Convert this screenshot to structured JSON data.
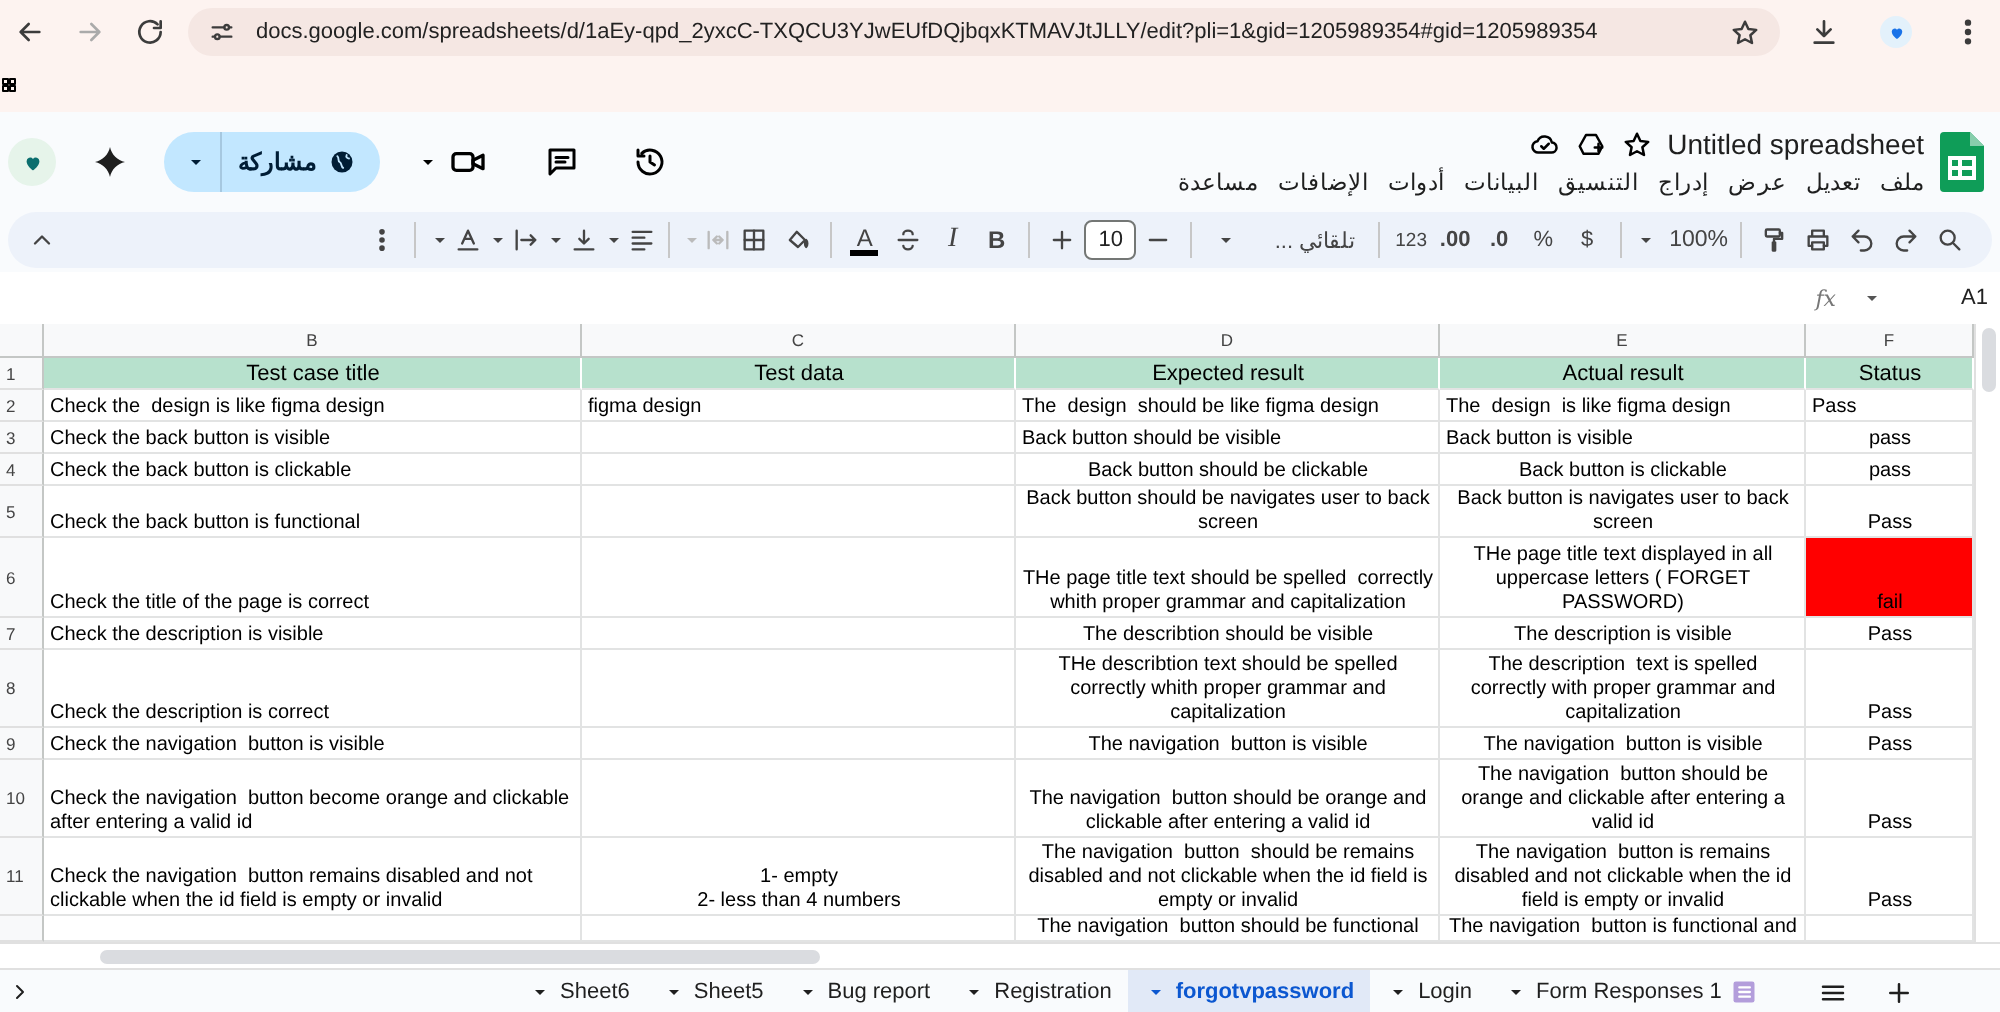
{
  "browser": {
    "url": "docs.google.com/spreadsheets/d/1aEy-qpd_2yxcC-TXQCU3YJwEUfDQjbqxKTMAVJtJLLY/edit?pli=1&gid=1205989354#gid=1205989354"
  },
  "document": {
    "title": "Untitled spreadsheet",
    "share_label": "مشاركة",
    "menu": [
      "ملف",
      "تعديل",
      "عرض",
      "إدراج",
      "التنسيق",
      "البيانات",
      "أدوات",
      "الإضافات",
      "مساعدة"
    ]
  },
  "toolbar": {
    "zoom": "100%",
    "currency": "$",
    "percent": "%",
    "decrease_decimals": ".0",
    "increase_decimals": ".00",
    "number_format": "123",
    "font": "تلقائي ...",
    "font_size": "10",
    "bold": "B",
    "italic": "I",
    "text_color": "A"
  },
  "formula_bar": {
    "fx": "fx",
    "cell_ref": "A1"
  },
  "table": {
    "columns": [
      "B",
      "C",
      "D",
      "E",
      "F"
    ],
    "header_row": {
      "number": "1",
      "cells": [
        "Test case title",
        "Test data",
        "Expected result",
        "Actual result",
        "Status"
      ]
    },
    "rows": [
      {
        "number": "2",
        "cells": [
          {
            "text": "Check the  design is like figma design",
            "centered": false
          },
          {
            "text": "figma design",
            "centered": false
          },
          {
            "text": "The  design  should be like figma design",
            "centered": false
          },
          {
            "text": "The  design  is like figma design",
            "centered": false
          },
          {
            "text": "Pass",
            "centered": false
          }
        ]
      },
      {
        "number": "3",
        "cells": [
          {
            "text": "Check the back button is visible",
            "centered": false
          },
          null,
          {
            "text": "Back button should be visible",
            "centered": false
          },
          {
            "text": "Back button is visible",
            "centered": false
          },
          {
            "text": "pass",
            "centered": true
          }
        ]
      },
      {
        "number": "4",
        "cells": [
          {
            "text": "Check the back button is clickable",
            "centered": false
          },
          null,
          {
            "text": "Back button should be clickable",
            "centered": true
          },
          {
            "text": "Back button is clickable",
            "centered": true
          },
          {
            "text": "pass",
            "centered": true
          }
        ]
      },
      {
        "number": "5",
        "cells": [
          {
            "text": "Check the back button is functional",
            "centered": false
          },
          null,
          {
            "text": "Back button should be navigates user to back screen",
            "centered": true
          },
          {
            "text": "Back button is navigates user to back screen",
            "centered": true
          },
          {
            "text": "Pass",
            "centered": true
          }
        ]
      },
      {
        "number": "6",
        "cells": [
          {
            "text": "Check the title of the page is correct",
            "centered": false
          },
          null,
          {
            "text": "THe page title text should be spelled  correctly whith proper grammar and capitalization",
            "centered": true
          },
          {
            "text": "THe page title text displayed in all uppercase letters ( FORGET PASSWORD)",
            "centered": true
          },
          {
            "text": "fail",
            "centered": true,
            "color": "#ff0000"
          }
        ]
      },
      {
        "number": "7",
        "cells": [
          {
            "text": "Check the description is visible",
            "centered": false
          },
          null,
          {
            "text": "The describtion should be visible",
            "centered": true
          },
          {
            "text": "The description is visible",
            "centered": true
          },
          {
            "text": "Pass",
            "centered": true
          }
        ]
      },
      {
        "number": "8",
        "cells": [
          {
            "text": "Check the description is correct",
            "centered": false
          },
          null,
          {
            "text": "THe describtion text should be spelled correctly whith proper grammar and capitalization",
            "centered": true
          },
          {
            "text": "The description  text is spelled  correctly with proper grammar and capitalization",
            "centered": true
          },
          {
            "text": "Pass",
            "centered": true
          }
        ]
      },
      {
        "number": "9",
        "cells": [
          {
            "text": "Check the navigation  button is visible",
            "centered": false
          },
          null,
          {
            "text": "The navigation  button is visible",
            "centered": true
          },
          {
            "text": "The navigation  button is visible",
            "centered": true
          },
          {
            "text": "Pass",
            "centered": true
          }
        ]
      },
      {
        "number": "10",
        "cells": [
          {
            "text": "Check the navigation  button become orange and clickable after entering a valid id",
            "centered": false
          },
          null,
          {
            "text": "The navigation  button should be orange and clickable after entering a valid id",
            "centered": true
          },
          {
            "text": "The navigation  button should be orange and clickable after entering a valid id",
            "centered": true
          },
          {
            "text": "Pass",
            "centered": true
          }
        ]
      },
      {
        "number": "11",
        "cells": [
          {
            "text": "Check the navigation  button remains disabled and not clickable when the id field is empty or invalid",
            "centered": false
          },
          {
            "text": "1- empty\n2- less than 4 numbers",
            "centered": true
          },
          {
            "text": "The navigation  button  should be remains disabled and not clickable when the id field is empty or invalid",
            "centered": true
          },
          {
            "text": "The navigation  button is remains disabled and not clickable when the id field is empty or invalid",
            "centered": true
          },
          {
            "text": "Pass",
            "centered": true
          }
        ]
      },
      {
        "cells": [
          null,
          null,
          {
            "text": "The navigation  button should be functional",
            "centered": true
          },
          {
            "text": "The navigation  button is functional and",
            "centered": true
          },
          null
        ]
      }
    ]
  },
  "sheet_tabs": [
    {
      "label": "Sheet6",
      "selected": false
    },
    {
      "label": "Sheet5",
      "selected": false
    },
    {
      "label": "Bug report",
      "selected": false
    },
    {
      "label": "Registration",
      "selected": false
    },
    {
      "label": "forgotvpassword",
      "selected": true
    },
    {
      "label": "Login",
      "selected": false
    },
    {
      "label": "Form Responses 1",
      "selected": false
    }
  ]
}
